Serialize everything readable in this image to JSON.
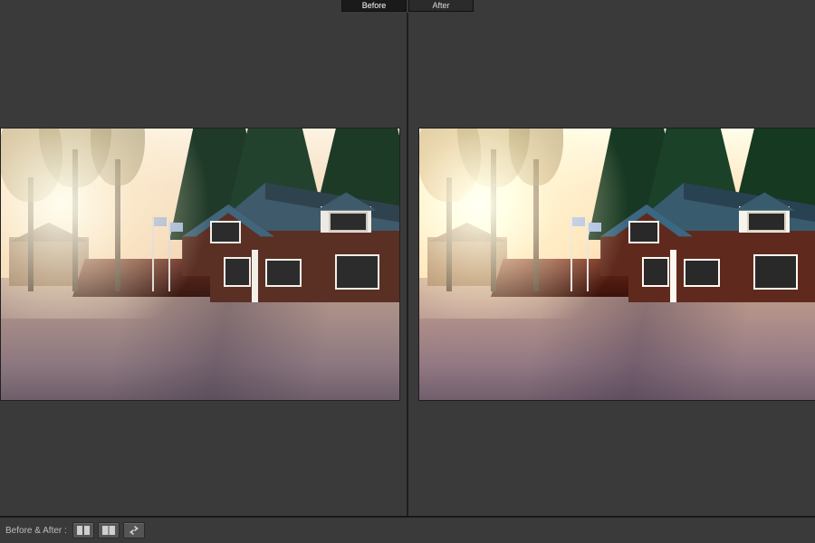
{
  "tabs": {
    "before": "Before",
    "after": "After"
  },
  "toolbar": {
    "label": "Before & After :",
    "btn_side_by_side": "side-by-side-view",
    "btn_split_view": "split-view",
    "btn_swap": "swap-before-after"
  }
}
